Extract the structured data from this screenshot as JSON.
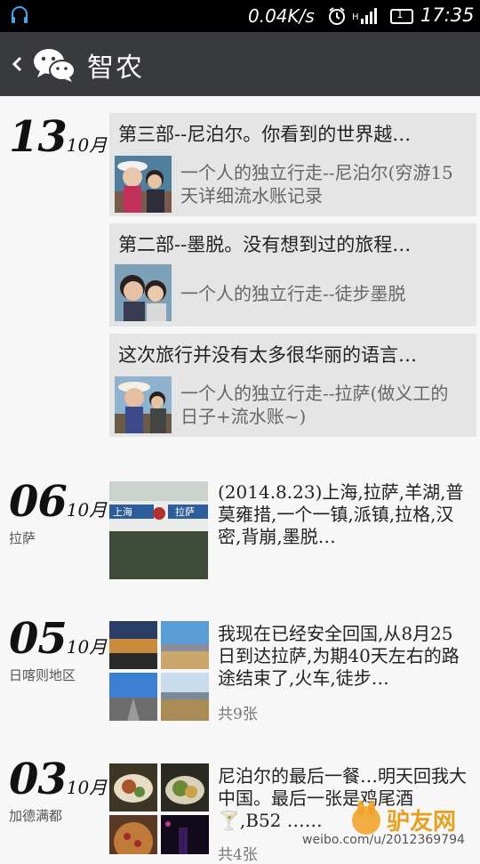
{
  "status_bar": {
    "speed": "0.04K/s",
    "time": "17:35",
    "sim": "1"
  },
  "header": {
    "title": "智农"
  },
  "feed": [
    {
      "day": "13",
      "month": "10月",
      "location": "",
      "cards": [
        {
          "title": "第三部--尼泊尔。你看到的世界越…",
          "subtitle": "一个人的独立行走--尼泊尔(穷游15天详细流水账记录"
        },
        {
          "title": "第二部--墨脱。没有想到过的旅程…",
          "subtitle": "一个人的独立行走--徒步墨脱"
        },
        {
          "title": "这次旅行并没有太多很华丽的语言…",
          "subtitle": "一个人的独立行走--拉萨(做义工的日子+流水账~)"
        }
      ]
    },
    {
      "day": "06",
      "month": "10月",
      "location": "拉萨",
      "text": "(2014.8.23)上海,拉萨,羊湖,普莫雍措,一个一镇,派镇,拉格,汉密,背崩,墨脱…",
      "image_label": {
        "sign_left": "上海",
        "sign_right": "拉萨"
      }
    },
    {
      "day": "05",
      "month": "10月",
      "location": "日喀则地区",
      "text": "我现在已经安全回国,从8月25日到达拉萨,为期40天左右的路途结束了,火车,徒步…",
      "count": "共9张"
    },
    {
      "day": "03",
      "month": "10月",
      "location": "加德满都",
      "text": "尼泊尔的最后一餐…明天回我大中国。最后一张是鸡尾酒🍸,B52 ……",
      "count": "共4张"
    }
  ],
  "watermark": {
    "text": "weibo.com/u/2012369794",
    "brand": "驴友网"
  }
}
